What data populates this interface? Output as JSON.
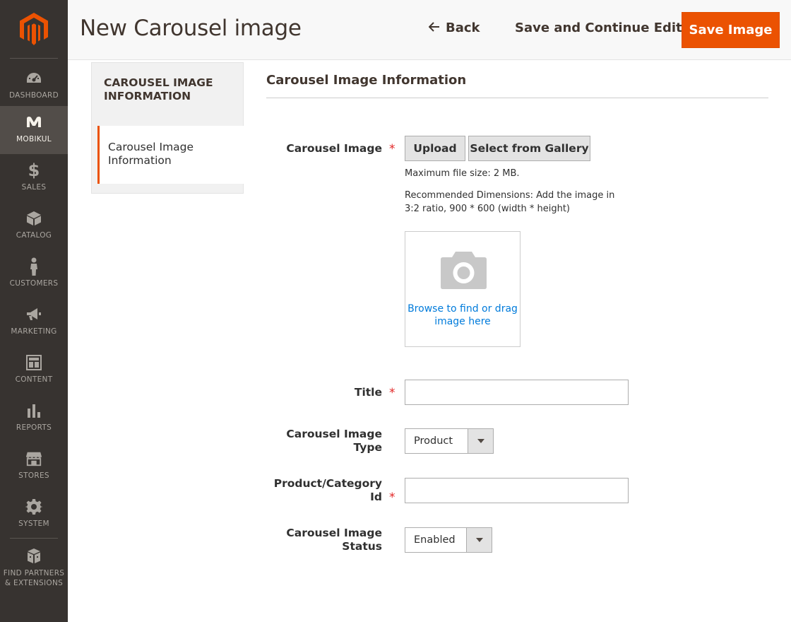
{
  "sidebar": {
    "items": [
      {
        "label": "DASHBOARD",
        "icon": "dashboard-icon"
      },
      {
        "label": "MOBIKUL",
        "icon": "mobikul-icon"
      },
      {
        "label": "SALES",
        "icon": "dollar-icon"
      },
      {
        "label": "CATALOG",
        "icon": "box-icon"
      },
      {
        "label": "CUSTOMERS",
        "icon": "person-icon"
      },
      {
        "label": "MARKETING",
        "icon": "megaphone-icon"
      },
      {
        "label": "CONTENT",
        "icon": "layout-icon"
      },
      {
        "label": "REPORTS",
        "icon": "bar-chart-icon"
      },
      {
        "label": "STORES",
        "icon": "storefront-icon"
      },
      {
        "label": "SYSTEM",
        "icon": "gear-icon"
      },
      {
        "label": "FIND PARTNERS & EXTENSIONS",
        "icon": "cubes-icon"
      }
    ],
    "active": "MOBIKUL"
  },
  "header": {
    "title": "New Carousel image",
    "back_label": "Back",
    "save_continue_label": "Save and Continue Edit",
    "save_label": "Save Image"
  },
  "tabs": {
    "title": "CAROUSEL IMAGE INFORMATION",
    "items": [
      {
        "label": "Carousel Image Information"
      }
    ]
  },
  "form": {
    "section_title": "Carousel Image Information",
    "image": {
      "label": "Carousel Image",
      "upload_label": "Upload",
      "gallery_label": "Select from Gallery",
      "max_size_note": "Maximum file size: 2 MB.",
      "dimensions_note": "Recommended Dimensions: Add the image in 3:2 ratio, 900 * 600 (width * height)",
      "drop_text": "Browse to find or drag image here"
    },
    "title_field": {
      "label": "Title",
      "value": ""
    },
    "type_field": {
      "label": "Carousel Image Type",
      "value": "Product"
    },
    "id_field": {
      "label": "Product/Category Id",
      "value": ""
    },
    "status_field": {
      "label": "Carousel Image Status",
      "value": "Enabled"
    }
  },
  "colors": {
    "accent": "#eb5202",
    "sidebar": "#373330",
    "link": "#007bdb",
    "required": "#e22626"
  }
}
